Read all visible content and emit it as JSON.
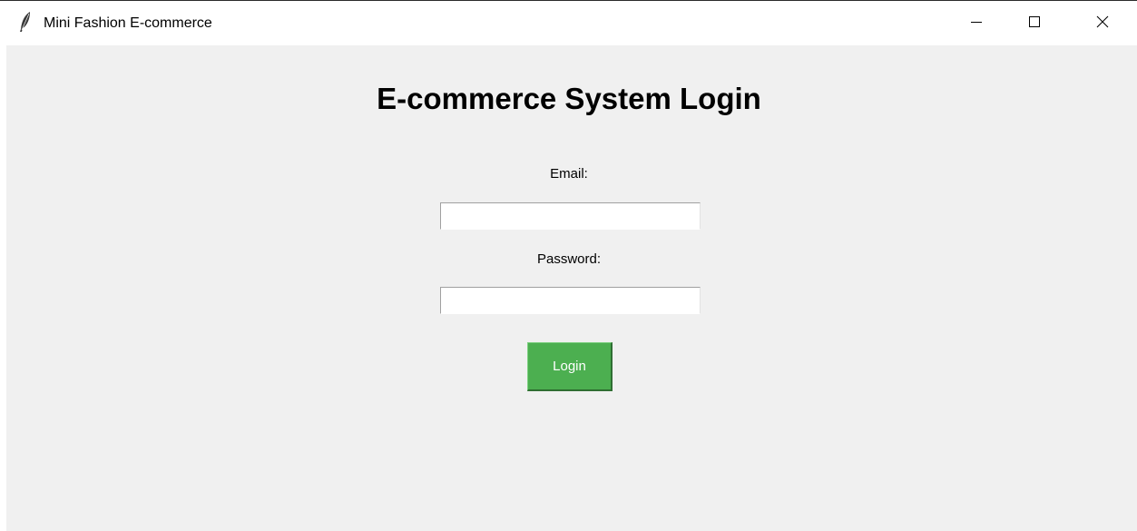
{
  "window": {
    "title": "Mini Fashion E-commerce",
    "icon": "feather-icon",
    "controls": {
      "minimize_icon": "minimize-icon",
      "maximize_icon": "maximize-icon",
      "close_icon": "close-icon"
    }
  },
  "login": {
    "heading": "E-commerce System Login",
    "email_label": "Email:",
    "email_value": "",
    "password_label": "Password:",
    "password_value": "",
    "button_label": "Login"
  },
  "colors": {
    "client_background": "#f0f0f0",
    "button_background": "#4caf50",
    "button_text": "#ffffff"
  }
}
